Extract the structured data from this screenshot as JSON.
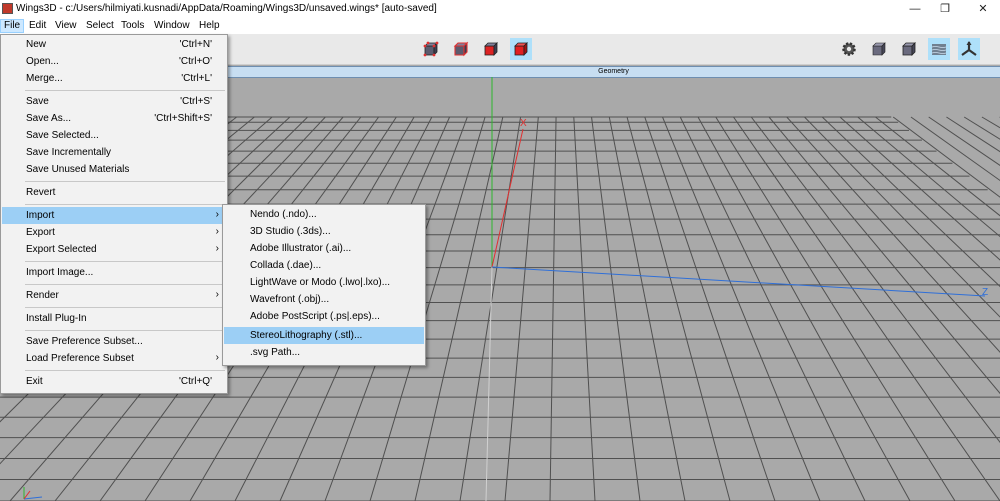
{
  "window": {
    "title": "Wings3D - c:/Users/hilmiyati.kusnadi/AppData/Roaming/Wings3D/unsaved.wings* [auto-saved]",
    "minimize": "—",
    "maximize": "❐",
    "close": "✕"
  },
  "menubar": [
    "File",
    "Edit",
    "View",
    "Select",
    "Tools",
    "Window",
    "Help"
  ],
  "toolbar": {
    "selection_modes": [
      "vertex-mode-icon",
      "edge-mode-icon",
      "face-mode-icon",
      "body-mode-icon"
    ],
    "right_tools": [
      "settings-gear-icon",
      "smooth-view-icon",
      "wireframe-view-icon",
      "ground-plane-icon",
      "axes-icon"
    ]
  },
  "viewport": {
    "header": "Geometry",
    "axis_x": "X",
    "axis_z": "Z"
  },
  "file_menu": {
    "items": [
      {
        "label": "New",
        "shortcut": "'Ctrl+N'"
      },
      {
        "label": "Open...",
        "shortcut": "'Ctrl+O'"
      },
      {
        "label": "Merge...",
        "shortcut": "'Ctrl+L'"
      },
      {
        "label": "Save",
        "shortcut": "'Ctrl+S'"
      },
      {
        "label": "Save As...",
        "shortcut": "'Ctrl+Shift+S'"
      },
      {
        "label": "Save Selected...",
        "shortcut": ""
      },
      {
        "label": "Save Incrementally",
        "shortcut": ""
      },
      {
        "label": "Save Unused Materials",
        "shortcut": ""
      },
      {
        "label": "Revert",
        "shortcut": ""
      },
      {
        "label": "Import",
        "shortcut": ""
      },
      {
        "label": "Export",
        "shortcut": ""
      },
      {
        "label": "Export Selected",
        "shortcut": ""
      },
      {
        "label": "Import Image...",
        "shortcut": ""
      },
      {
        "label": "Render",
        "shortcut": ""
      },
      {
        "label": "Install Plug-In",
        "shortcut": ""
      },
      {
        "label": "Save Preference Subset...",
        "shortcut": ""
      },
      {
        "label": "Load Preference Subset",
        "shortcut": ""
      },
      {
        "label": "Exit",
        "shortcut": "'Ctrl+Q'"
      }
    ]
  },
  "import_menu": {
    "items": [
      "Nendo (.ndo)...",
      "3D Studio (.3ds)...",
      "Adobe Illustrator (.ai)...",
      "Collada (.dae)...",
      "LightWave or Modo (.lwo|.lxo)...",
      "Wavefront (.obj)...",
      "Adobe PostScript (.ps|.eps)...",
      "StereoLithography (.stl)...",
      ".svg Path..."
    ],
    "highlighted": "StereoLithography (.stl)..."
  },
  "colors": {
    "viewport_bg": "#a9a9a9",
    "grid": "#505050",
    "axis_x": "#e03030",
    "axis_y": "#2db82d",
    "axis_z": "#2f6fd8",
    "menu_highlight": "#9ccff5"
  }
}
